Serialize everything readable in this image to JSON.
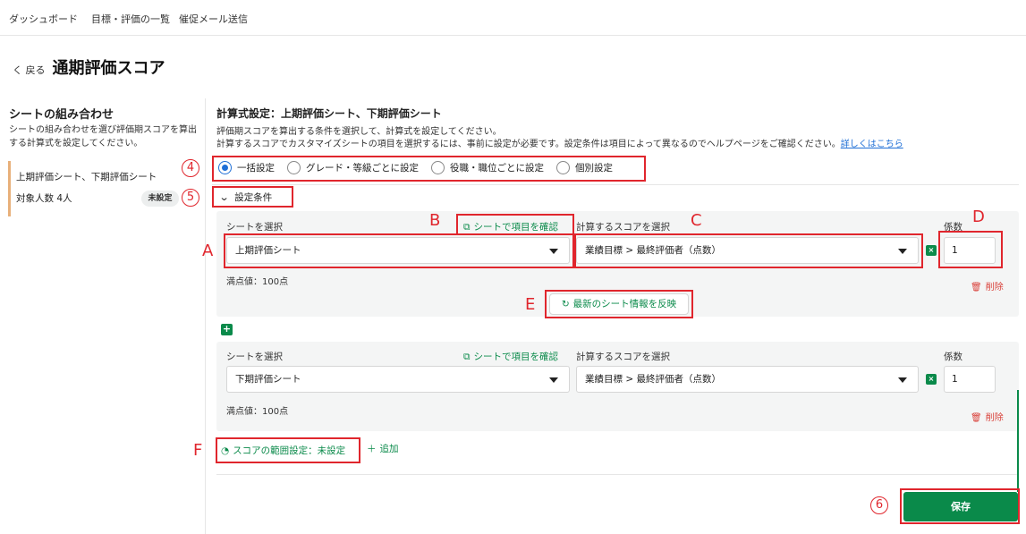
{
  "nav": {
    "items": [
      "ダッシュボード",
      "目標・評価の一覧",
      "催促メール送信"
    ]
  },
  "header": {
    "back_label": "く 戻る",
    "title": "通期評価スコア"
  },
  "sidebar": {
    "title": "シートの組み合わせ",
    "description": "シートの組み合わせを選び評価期スコアを算出する計算式を設定してください。",
    "item_label": "上期評価シート、下期評価シート",
    "count_label": "対象人数 4人",
    "status_badge": "未設定"
  },
  "main": {
    "title": "計算式設定：上期評価シート、下期評価シート",
    "desc_line1": "評価期スコアを算出する条件を選択して、計算式を設定してください。",
    "desc_line2": "計算するスコアでカスタマイズシートの項目を選択するには、事前に設定が必要です。設定条件は項目によって異なるのでヘルプページをご確認ください。",
    "help_link": "詳しくはこちら",
    "radio_options": [
      "一括設定",
      "グレード・等級ごとに設定",
      "役職・職位ごとに設定",
      "個別設定"
    ],
    "selected_radio": "一括設定",
    "conditions_label": "設定条件",
    "rows": [
      {
        "sheet_label": "シートを選択",
        "sheet_value": "上期評価シート",
        "check_link": "シートで項目を確認",
        "score_label": "計算するスコアを選択",
        "score_value": "業績目標 > 最終評価者（点数）",
        "coef_label": "係数",
        "coef_value": "1",
        "full_score": "満点値：100点",
        "delete_label": "削除"
      },
      {
        "sheet_label": "シートを選択",
        "sheet_value": "下期評価シート",
        "check_link": "シートで項目を確認",
        "score_label": "計算するスコアを選択",
        "score_value": "業績目標 > 最終評価者（点数）",
        "coef_label": "係数",
        "coef_value": "1",
        "full_score": "満点値：100点",
        "delete_label": "削除"
      }
    ],
    "refresh_label": "最新のシート情報を反映",
    "score_range_label": "スコアの範囲設定：未設定",
    "add_label": "追加",
    "save_label": "保存"
  },
  "annotations": {
    "letters": [
      "A",
      "B",
      "C",
      "D",
      "E",
      "F"
    ],
    "numbers": [
      "4",
      "5",
      "6"
    ],
    "color": "#e0262d"
  },
  "colors": {
    "accent_green": "#0a8a4a",
    "radio_blue": "#1f6fd6",
    "delete_red": "#d9413a",
    "sidebar_bar": "#e8b07a"
  }
}
